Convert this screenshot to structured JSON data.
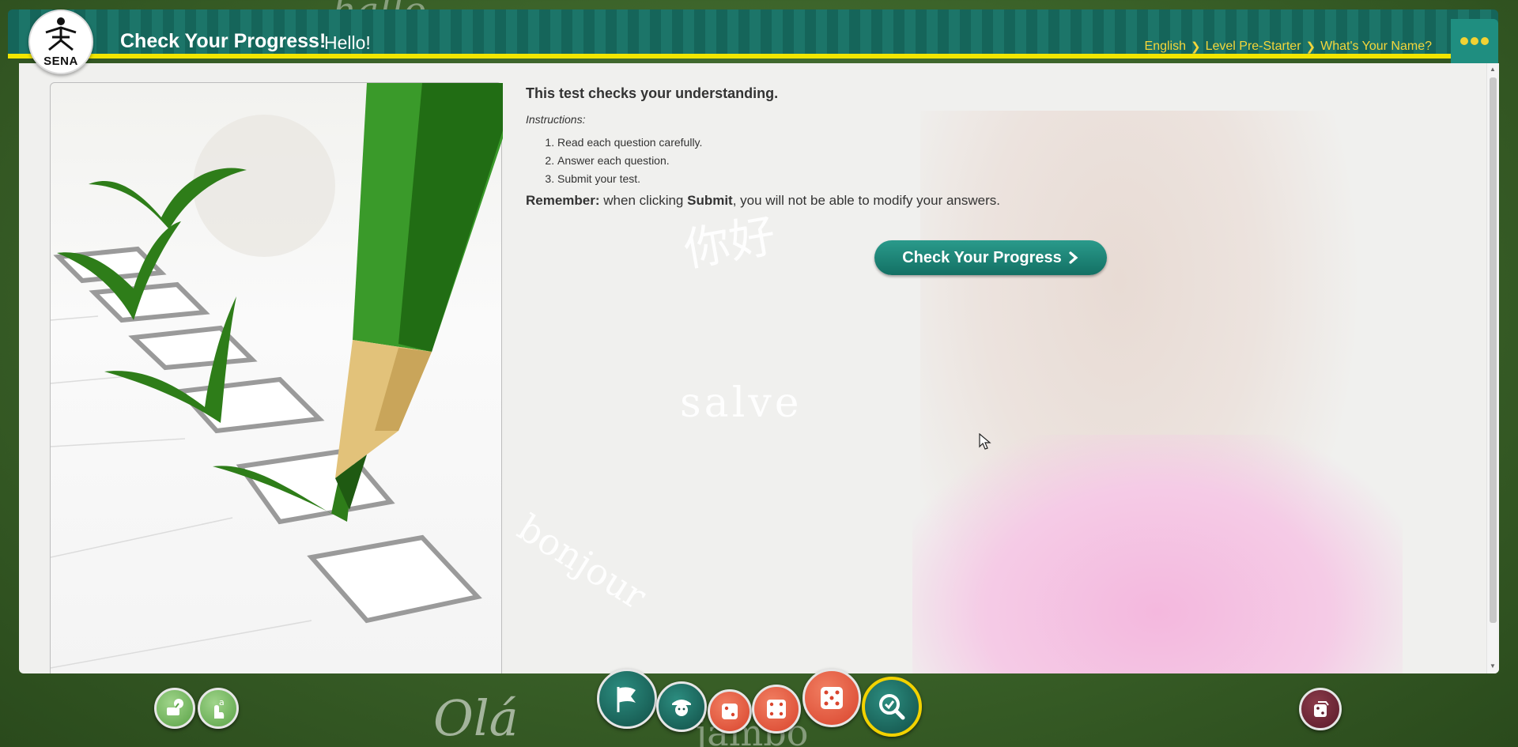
{
  "header": {
    "logo_text": "SENA",
    "title": "Check Your Progress!",
    "subtitle": "Hello!",
    "breadcrumb": [
      "English",
      "Level Pre-Starter",
      "What's Your Name?"
    ]
  },
  "main": {
    "heading": "This test checks your understanding.",
    "instructions_label": "Instructions:",
    "steps": [
      "Read each question carefully.",
      "Answer each question.",
      "Submit your test."
    ],
    "remember_label": "Remember:",
    "remember_text_1": " when clicking ",
    "remember_submit": "Submit",
    "remember_text_2": ", you will not be able to modify your answers.",
    "cta_label": "Check Your Progress"
  },
  "background_words": {
    "salve": "salve",
    "bonjour": "bonjour",
    "nihao": "你好",
    "ola": "Olá",
    "jambo": "jambo",
    "hallo": "hallo"
  },
  "toolbar": {
    "left": [
      "grammar-icon",
      "touch-text-icon"
    ],
    "center": [
      "flag-icon",
      "student-icon",
      "dice-icon",
      "dice-icon",
      "dice-icon",
      "progress-search-icon"
    ],
    "right": [
      "dice-box-icon"
    ],
    "active_item": "progress-search-icon"
  },
  "colors": {
    "header_teal": "#15655a",
    "header_underline": "#f2e600",
    "breadcrumb": "#f4d63a",
    "cta": "#137064"
  }
}
